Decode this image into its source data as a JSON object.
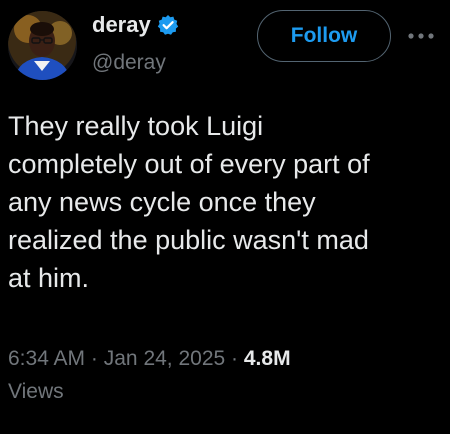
{
  "author": {
    "display_name": "deray",
    "handle": "@deray",
    "verified_color": "#1d9bf0"
  },
  "actions": {
    "follow_label": "Follow",
    "more_icon": "more-horizontal-icon"
  },
  "tweet": {
    "text": "They really took Luigi\ncompletely out of every part of\nany news cycle once they\nrealized the public wasn't mad\nat him."
  },
  "meta": {
    "time": "6:34 AM",
    "separator": "·",
    "date": "Jan 24, 2025",
    "views_count": "4.8M",
    "views_label": "Views"
  },
  "colors": {
    "background": "#000000",
    "text": "#e7e9ea",
    "secondary": "#71767b",
    "accent": "#1d9bf0"
  }
}
